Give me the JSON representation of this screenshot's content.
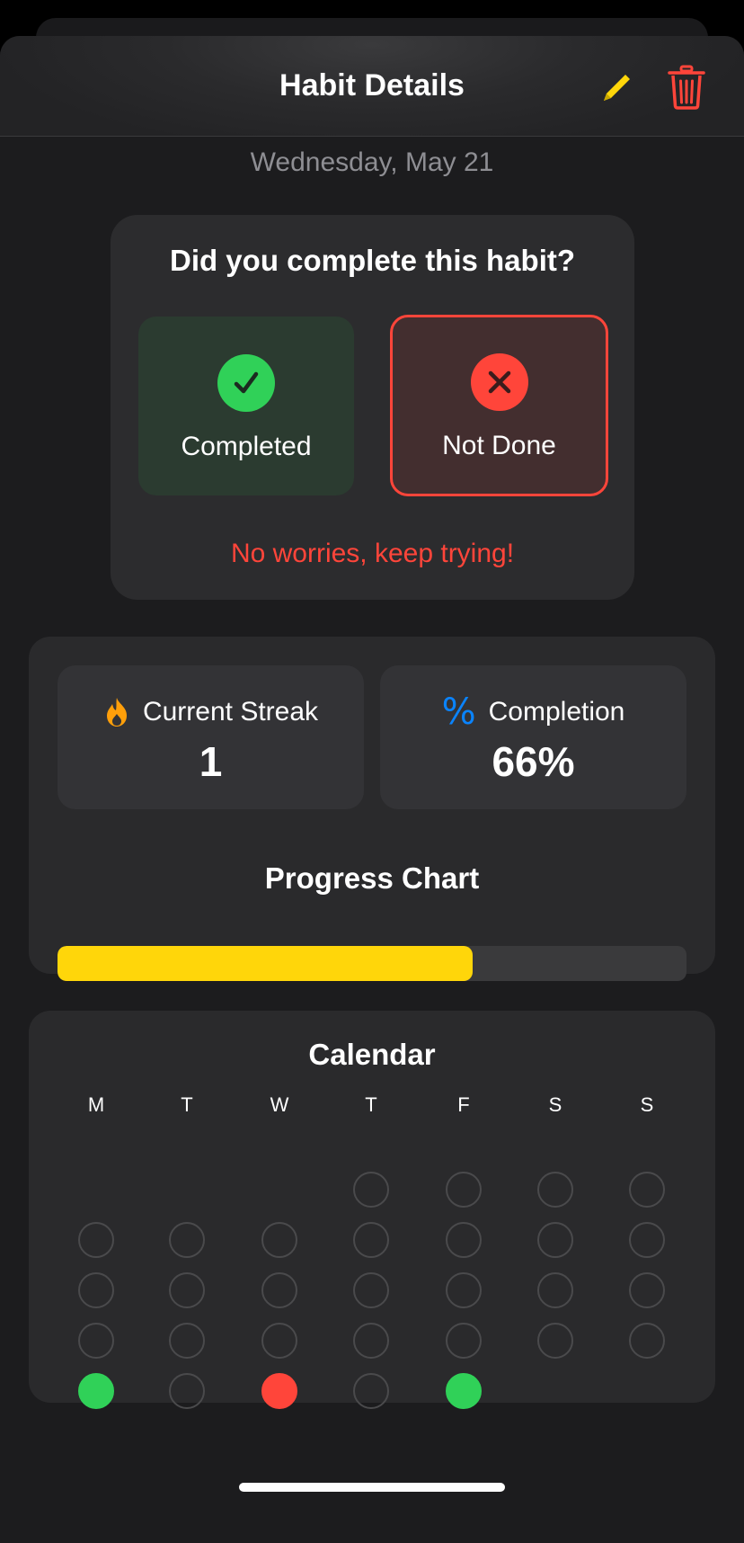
{
  "header": {
    "title": "Habit Details",
    "edit_icon": "pencil-icon",
    "delete_icon": "trash-icon",
    "edit_color": "#ffd60a",
    "delete_color": "#ff453a"
  },
  "date_label": "Wednesday, May 21",
  "completion_prompt": {
    "question": "Did you complete this habit?",
    "options": [
      {
        "label": "Completed",
        "icon": "checkmark-icon",
        "color": "#30d158",
        "selected": false
      },
      {
        "label": "Not Done",
        "icon": "xmark-icon",
        "color": "#ff453a",
        "selected": true
      }
    ],
    "feedback": "No worries, keep trying!"
  },
  "stats": {
    "current_streak": {
      "label": "Current Streak",
      "value": "1",
      "icon": "flame-icon",
      "icon_color": "#ff9f0a"
    },
    "completion": {
      "label": "Completion",
      "value": "66%",
      "icon": "percent-icon",
      "icon_color": "#0a84ff"
    }
  },
  "progress_chart": {
    "title": "Progress Chart",
    "fraction": 0.66,
    "fill_color": "#ffd60a"
  },
  "calendar": {
    "title": "Calendar",
    "weekdays": [
      "M",
      "T",
      "W",
      "T",
      "F",
      "S",
      "S"
    ],
    "weeks": [
      [
        "none",
        "none",
        "none",
        "empty",
        "empty",
        "empty",
        "empty"
      ],
      [
        "empty",
        "empty",
        "empty",
        "empty",
        "empty",
        "empty",
        "empty"
      ],
      [
        "empty",
        "empty",
        "empty",
        "empty",
        "empty",
        "empty",
        "empty"
      ],
      [
        "empty",
        "empty",
        "empty",
        "empty",
        "empty",
        "empty",
        "empty"
      ],
      [
        "done",
        "empty",
        "missed",
        "empty",
        "done",
        "none",
        "none"
      ]
    ],
    "status_colors": {
      "done": "#30d158",
      "missed": "#ff453a"
    }
  }
}
